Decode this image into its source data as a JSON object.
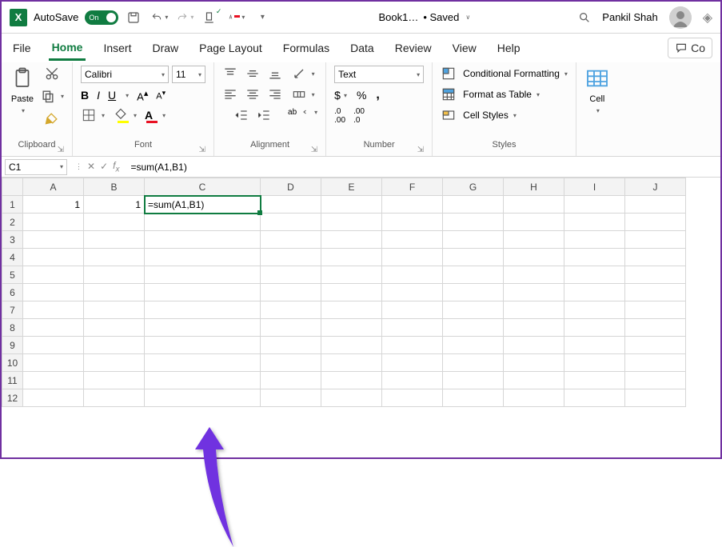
{
  "title_bar": {
    "autosave_label": "AutoSave",
    "toggle_text": "On",
    "filename": "Book1…",
    "status": "• Saved",
    "user_name": "Pankil Shah"
  },
  "ribbon": {
    "tabs": [
      "File",
      "Home",
      "Insert",
      "Draw",
      "Page Layout",
      "Formulas",
      "Data",
      "Review",
      "View",
      "Help"
    ],
    "active_tab": "Home",
    "comments_label": "Co",
    "clipboard": {
      "paste_label": "Paste",
      "group_label": "Clipboard"
    },
    "font": {
      "group_label": "Font",
      "font_name": "Calibri",
      "font_size": "11",
      "bold": "B",
      "italic": "I",
      "underline": "U"
    },
    "alignment": {
      "group_label": "Alignment",
      "wrap_label": "ab"
    },
    "number": {
      "group_label": "Number",
      "format": "Text",
      "currency": "$",
      "percent": "%",
      "comma": ","
    },
    "styles": {
      "group_label": "Styles",
      "cond_fmt": "Conditional Formatting",
      "as_table": "Format as Table",
      "cell_styles": "Cell Styles"
    },
    "cells": {
      "label": "Cell"
    }
  },
  "formula_bar": {
    "namebox": "C1",
    "formula": "=sum(A1,B1)"
  },
  "grid": {
    "columns": [
      "A",
      "B",
      "C",
      "D",
      "E",
      "F",
      "G",
      "H",
      "I",
      "J"
    ],
    "wide_col": "C",
    "rows": [
      {
        "n": 1,
        "A": "1",
        "B": "1",
        "C": "=sum(A1,B1)"
      },
      {
        "n": 2
      },
      {
        "n": 3
      },
      {
        "n": 4
      },
      {
        "n": 5
      },
      {
        "n": 6
      },
      {
        "n": 7
      },
      {
        "n": 8
      },
      {
        "n": 9
      },
      {
        "n": 10
      },
      {
        "n": 11
      },
      {
        "n": 12
      }
    ],
    "active_cell": "C1"
  }
}
